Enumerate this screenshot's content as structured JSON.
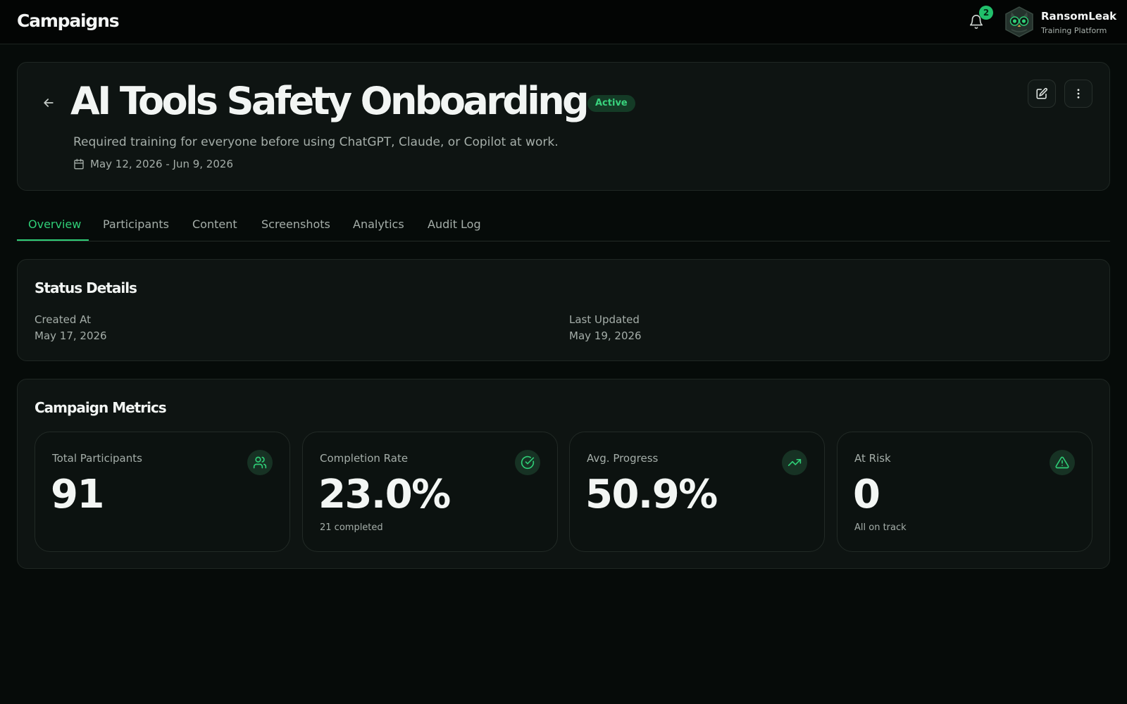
{
  "header": {
    "title": "Campaigns",
    "notifications_count": "2",
    "brand_name": "RansomLeak",
    "brand_subtitle": "Training Platform"
  },
  "campaign": {
    "title": "AI Tools Safety Onboarding",
    "status": "Active",
    "description": "Required training for everyone before using ChatGPT, Claude, or Copilot at work.",
    "date_range": "May 12, 2026 - Jun 9, 2026"
  },
  "tabs": [
    {
      "label": "Overview",
      "active": true
    },
    {
      "label": "Participants",
      "active": false
    },
    {
      "label": "Content",
      "active": false
    },
    {
      "label": "Screenshots",
      "active": false
    },
    {
      "label": "Analytics",
      "active": false
    },
    {
      "label": "Audit Log",
      "active": false
    }
  ],
  "status_details": {
    "title": "Status Details",
    "created_label": "Created At",
    "created_value": "May 17, 2026",
    "updated_label": "Last Updated",
    "updated_value": "May 19, 2026"
  },
  "metrics": {
    "title": "Campaign Metrics",
    "items": [
      {
        "label": "Total Participants",
        "value": "91",
        "note": "",
        "icon": "users-icon"
      },
      {
        "label": "Completion Rate",
        "value": "23.0%",
        "note": "21 completed",
        "icon": "check-circle-icon"
      },
      {
        "label": "Avg. Progress",
        "value": "50.9%",
        "note": "",
        "icon": "trending-up-icon"
      },
      {
        "label": "At Risk",
        "value": "0",
        "note": "All on track",
        "icon": "alert-triangle-icon"
      }
    ]
  },
  "colors": {
    "accent": "#2fcd76",
    "background": "#060b09",
    "card": "#0e1412"
  }
}
